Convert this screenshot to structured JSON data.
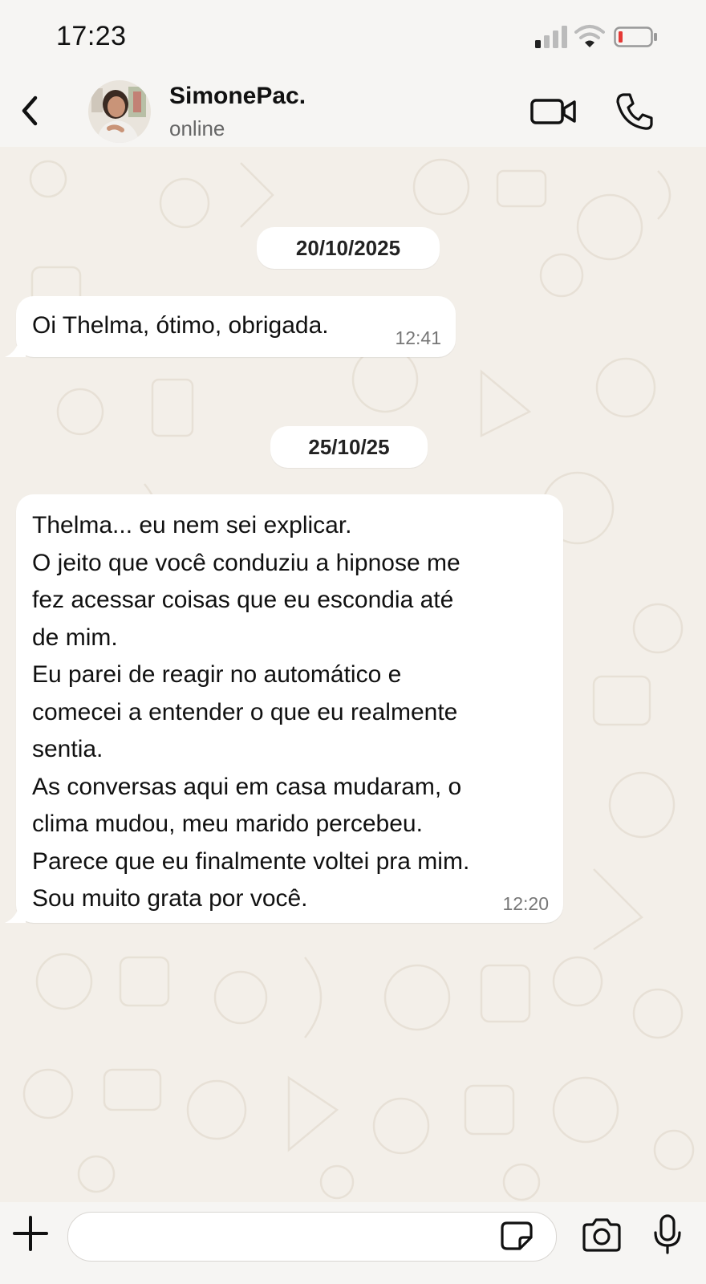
{
  "status_bar": {
    "time": "17:23"
  },
  "header": {
    "contact_name": "SimonePac.",
    "status": "online"
  },
  "chat": {
    "date_chips": [
      "20/10/2025",
      "25/10/25"
    ],
    "messages": [
      {
        "text": "Oi Thelma, ótimo, obrigada.",
        "time": "12:41"
      },
      {
        "lines": [
          "Thelma... eu nem sei explicar.",
          "O jeito que você conduziu a hipnose me",
          "fez acessar coisas que eu escondia até",
          "de mim.",
          "Eu parei de reagir no automático e",
          "comecei a entender o que eu realmente",
          "sentia.",
          "As conversas aqui em casa mudaram, o",
          "clima mudou, meu marido percebeu.",
          "Parece que eu finalmente voltei pra mim.",
          "Sou muito grata por você."
        ],
        "time": "12:20"
      }
    ]
  },
  "input_bar": {
    "placeholder": ""
  },
  "icons": {
    "back": "chevron-left-icon",
    "video": "video-camera-icon",
    "call": "phone-icon",
    "plus": "plus-icon",
    "sticker": "sticker-icon",
    "camera": "camera-icon",
    "mic": "microphone-icon"
  },
  "colors": {
    "background": "#f3efe9",
    "bubble": "#ffffff",
    "battery_low": "#e53935"
  }
}
